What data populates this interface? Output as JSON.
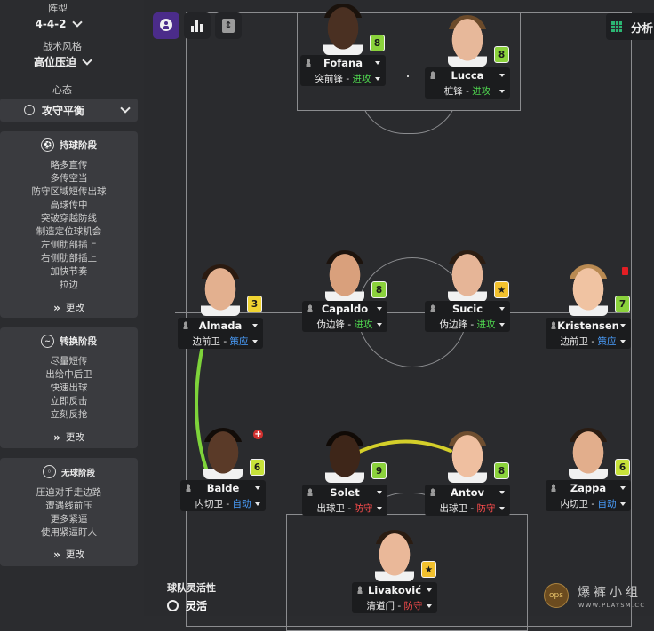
{
  "sidebar": {
    "formation_label": "阵型",
    "formation_value": "4-4-2",
    "style_label": "战术风格",
    "style_value": "高位压迫",
    "mentality_label": "心态",
    "mentality_value": "攻守平衡",
    "phases": [
      {
        "title": "持球阶段",
        "items": [
          "略多直传",
          "多传空当",
          "防守区域短传出球",
          "高球传中",
          "突破穿越防线",
          "制造定位球机会",
          "左侧肋部插上",
          "右侧肋部插上",
          "加快节奏",
          "拉边"
        ],
        "change_label": "更改"
      },
      {
        "title": "转换阶段",
        "items": [
          "尽量短传",
          "出给中后卫",
          "快速出球",
          "立即反击",
          "立刻反抢"
        ],
        "change_label": "更改"
      },
      {
        "title": "无球阶段",
        "items": [
          "压迫对手走边路",
          "遭遇线前压",
          "更多紧逼",
          "使用紧逼盯人"
        ],
        "change_label": "更改"
      }
    ]
  },
  "toolbar": {
    "analysis_label": "分析"
  },
  "players": [
    {
      "name": "Fofana",
      "role": "突前锋",
      "duty": "进攻",
      "duty_type": "attack",
      "rating": "8",
      "badge_color": "#8bd23c",
      "skin": "#4a3022",
      "hair": "#1a120c"
    },
    {
      "name": "Lucca",
      "role": "桩锋",
      "duty": "进攻",
      "duty_type": "attack",
      "rating": "8",
      "badge_color": "#8bd23c",
      "skin": "#e7b89a",
      "hair": "#6b4a2a"
    },
    {
      "name": "Almada",
      "role": "边前卫",
      "duty": "策应",
      "duty_type": "support",
      "rating": "3",
      "badge_color": "#f0d431",
      "skin": "#e3b08f",
      "hair": "#2a1a10"
    },
    {
      "name": "Capaldo",
      "role": "伪边锋",
      "duty": "进攻",
      "duty_type": "attack",
      "rating": "8",
      "badge_color": "#8bd23c",
      "skin": "#d9a07c",
      "hair": "#1c130d"
    },
    {
      "name": "Sucic",
      "role": "伪边锋",
      "duty": "进攻",
      "duty_type": "attack",
      "rating": "★",
      "badge_color": "#f2c12e",
      "skin": "#e6b597",
      "hair": "#2c1d12"
    },
    {
      "name": "Kristensen",
      "role": "边前卫",
      "duty": "策应",
      "duty_type": "support",
      "rating": "7",
      "badge_color": "#8bd23c",
      "skin": "#f0c3a2",
      "hair": "#b98a52"
    },
    {
      "name": "Balde",
      "role": "内切卫",
      "duty": "自动",
      "duty_type": "auto",
      "rating": "6",
      "badge_color": "#c7e23a",
      "skin": "#5a3a28",
      "hair": "#120c08"
    },
    {
      "name": "Solet",
      "role": "出球卫",
      "duty": "防守",
      "duty_type": "defend",
      "rating": "9",
      "badge_color": "#8bd23c",
      "skin": "#3e2619",
      "hair": "#100a06"
    },
    {
      "name": "Antov",
      "role": "出球卫",
      "duty": "防守",
      "duty_type": "defend",
      "rating": "8",
      "badge_color": "#8bd23c",
      "skin": "#efbfa0",
      "hair": "#6e4e30"
    },
    {
      "name": "Zappa",
      "role": "内切卫",
      "duty": "自动",
      "duty_type": "auto",
      "rating": "6",
      "badge_color": "#c7e23a",
      "skin": "#e2ae8c",
      "hair": "#2a1c12"
    },
    {
      "name": "Livaković",
      "role": "清道门",
      "duty": "防守",
      "duty_type": "defend",
      "rating": "★",
      "badge_color": "#f2c12e",
      "skin": "#eab899",
      "hair": "#2a1c12"
    }
  ],
  "team_fluidity": {
    "label": "球队灵活性",
    "value": "灵活"
  },
  "watermark": {
    "text": "爆裤小组",
    "url": "WWW.PLAYSM.CC"
  },
  "colors": {
    "attack": "#4fd64f",
    "support": "#4a9fff",
    "defend": "#ff4d4d",
    "link_green": "#7ed33a",
    "link_yellow": "#d4cf2a"
  }
}
